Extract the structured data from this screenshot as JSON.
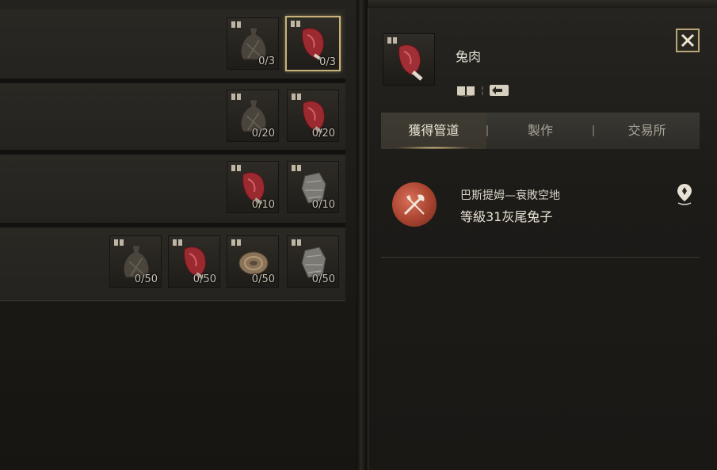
{
  "recipes": [
    {
      "materials": [
        {
          "name": "cloth-sack",
          "count": "0/3"
        },
        {
          "name": "rabbit-meat",
          "count": "0/3",
          "selected": true
        }
      ]
    },
    {
      "materials": [
        {
          "name": "cloth-sack",
          "count": "0/20"
        },
        {
          "name": "rabbit-meat",
          "count": "0/20"
        }
      ]
    },
    {
      "materials": [
        {
          "name": "rabbit-meat",
          "count": "0/10"
        },
        {
          "name": "gray-fabric",
          "count": "0/10"
        }
      ]
    },
    {
      "materials": [
        {
          "name": "cloth-sack",
          "count": "0/50"
        },
        {
          "name": "rabbit-meat",
          "count": "0/50"
        },
        {
          "name": "rope-coil",
          "count": "0/50"
        },
        {
          "name": "gray-fabric",
          "count": "0/50"
        }
      ]
    }
  ],
  "detail": {
    "item_name": "兔肉",
    "icons": [
      "book-icon",
      "return-icon"
    ]
  },
  "tabs": [
    "獲得管道",
    "製作",
    "交易所"
  ],
  "active_tab": 0,
  "source": {
    "location": "巴斯提姆—衰敗空地",
    "monster": "等級31灰尾兔子"
  },
  "colors": {
    "accent_gold": "#c9b27a",
    "meat_red": "#b0323a",
    "source_red": "#a8432f"
  }
}
